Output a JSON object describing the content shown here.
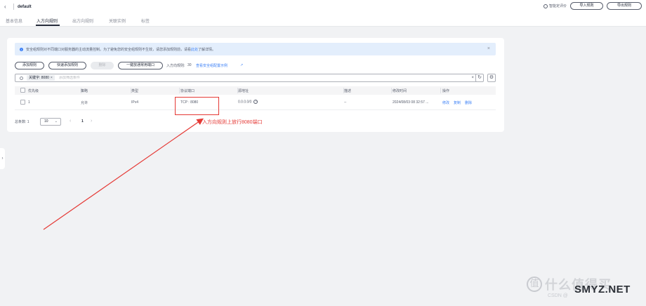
{
  "header": {
    "back_symbol": "‹",
    "title": "default",
    "feedback_label": "智能定评价",
    "import_button": "导入规则",
    "export_button": "导出规则"
  },
  "tabs": [
    {
      "label": "基本信息",
      "active": false
    },
    {
      "label": "入方向规则",
      "active": true
    },
    {
      "label": "出方向规则",
      "active": false
    },
    {
      "label": "关联实例",
      "active": false
    },
    {
      "label": "标签",
      "active": false
    }
  ],
  "notice": {
    "text": "安全组规则对不同端口对服务器的主动流量控制。为了避免您的安全组规则不生效，请您添加规则前，请看",
    "link": "此处",
    "suffix": "了解详情。",
    "close_symbol": "×"
  },
  "toolbar": {
    "add_rule": "添加规则",
    "quick_add_rule": "快速添加规则",
    "delete": "删除",
    "open_common_ports": "一键放通常用端口",
    "inbound_rules_label": "入方向规则:",
    "inbound_rules_count": "30",
    "view_link": "查看安全组配置示例"
  },
  "search": {
    "chip_label": "关键字: 8080",
    "chip_close": "×",
    "placeholder": "添加筛选条件",
    "clear_symbol": "×"
  },
  "table": {
    "columns": [
      "优先级",
      "策略",
      "类型",
      "协议端口",
      "源地址",
      "描述",
      "修改时间",
      "操作"
    ],
    "rows": [
      {
        "priority": "1",
        "policy": "允许",
        "type": "IPv4",
        "protocol_port": "TCP : 8080",
        "source": "0.0.0.0/0",
        "description": "--",
        "modified": "2024/08/03 08 32:57 ...",
        "ops": [
          "修改",
          "复制",
          "删除"
        ]
      }
    ]
  },
  "pager": {
    "total_label": "总条数: 1",
    "page_size": "10",
    "current_page": "1"
  },
  "annotation": {
    "text": "入方向规则上放行8080端口",
    "color": "#e53935"
  },
  "watermark": {
    "logo_char": "值",
    "text": "什么值得买",
    "site": "SMYZ.NET",
    "csdn": "CSDN @"
  },
  "colors": {
    "accent": "#3c80f6",
    "annotation_red": "#e53935"
  }
}
